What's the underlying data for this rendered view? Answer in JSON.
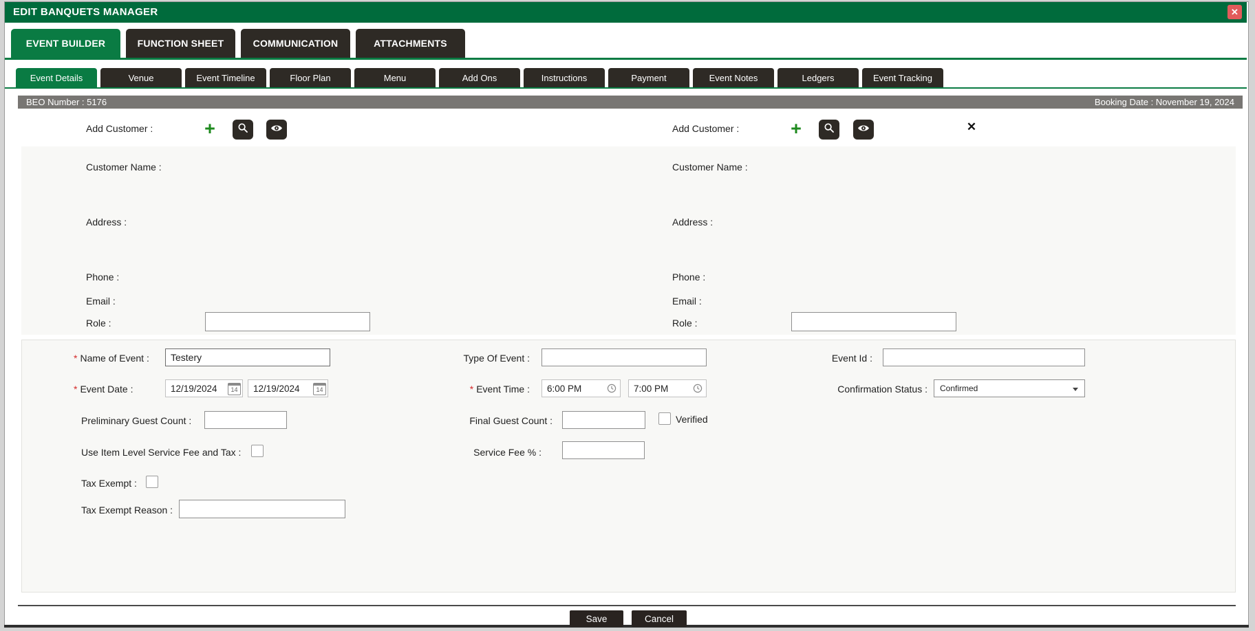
{
  "title_bar": {
    "title": "EDIT BANQUETS MANAGER",
    "close_glyph": "✕"
  },
  "colors": {
    "brand_green": "#0A7B43",
    "titlebar_green": "#006B3C",
    "tab_dark": "#2E2A25",
    "close_red": "#E25B5B",
    "info_bar_gray": "#787673"
  },
  "tabs": {
    "main": [
      {
        "label": "EVENT BUILDER",
        "active": true
      },
      {
        "label": "FUNCTION SHEET",
        "active": false
      },
      {
        "label": "COMMUNICATION",
        "active": false
      },
      {
        "label": "ATTACHMENTS",
        "active": false
      }
    ],
    "sub": [
      {
        "label": "Event Details",
        "active": true
      },
      {
        "label": "Venue",
        "active": false
      },
      {
        "label": "Event Timeline",
        "active": false
      },
      {
        "label": "Floor Plan",
        "active": false
      },
      {
        "label": "Menu",
        "active": false
      },
      {
        "label": "Add Ons",
        "active": false
      },
      {
        "label": "Instructions",
        "active": false
      },
      {
        "label": "Payment",
        "active": false
      },
      {
        "label": "Event Notes",
        "active": false
      },
      {
        "label": "Ledgers",
        "active": false
      },
      {
        "label": "Event Tracking",
        "active": false
      }
    ]
  },
  "info_bar": {
    "beo_number": "BEO Number : 5176",
    "booking_date": "Booking Date : November 19, 2024"
  },
  "icons": {
    "plus_glyph": "+",
    "remove_glyph": "✕",
    "calendar_day": "14"
  },
  "customer_left": {
    "add_label": "Add Customer :",
    "name_label": "Customer Name :",
    "address_label": "Address :",
    "phone_label": "Phone :",
    "email_label": "Email :",
    "role_label": "Role :",
    "role_value": ""
  },
  "customer_right": {
    "add_label": "Add Customer :",
    "name_label": "Customer Name :",
    "address_label": "Address :",
    "phone_label": "Phone :",
    "email_label": "Email :",
    "role_label": "Role :",
    "role_value": ""
  },
  "form": {
    "required_marker": "*",
    "name_of_event": {
      "label": "Name of Event :",
      "value": "Testery"
    },
    "type_of_event": {
      "label": "Type Of Event :",
      "value": ""
    },
    "event_id": {
      "label": "Event Id :",
      "value": ""
    },
    "event_date": {
      "label": "Event Date :",
      "start": "12/19/2024",
      "end": "12/19/2024"
    },
    "event_time": {
      "label": "Event Time :",
      "start": "6:00 PM",
      "end": "7:00 PM"
    },
    "confirmation_status": {
      "label": "Confirmation Status :",
      "value": "Confirmed"
    },
    "preliminary_guest_count": {
      "label": "Preliminary Guest Count :",
      "value": ""
    },
    "final_guest_count": {
      "label": "Final Guest Count :",
      "value": ""
    },
    "verified": {
      "label": "Verified",
      "checked": false
    },
    "use_item_level": {
      "label": "Use Item Level Service Fee and Tax :",
      "checked": false
    },
    "service_fee": {
      "label": "Service Fee % :",
      "value": ""
    },
    "tax_exempt": {
      "label": "Tax Exempt :",
      "checked": false
    },
    "tax_exempt_reason": {
      "label": "Tax Exempt Reason :",
      "value": ""
    }
  },
  "footer": {
    "save_label": "Save",
    "cancel_label": "Cancel"
  }
}
